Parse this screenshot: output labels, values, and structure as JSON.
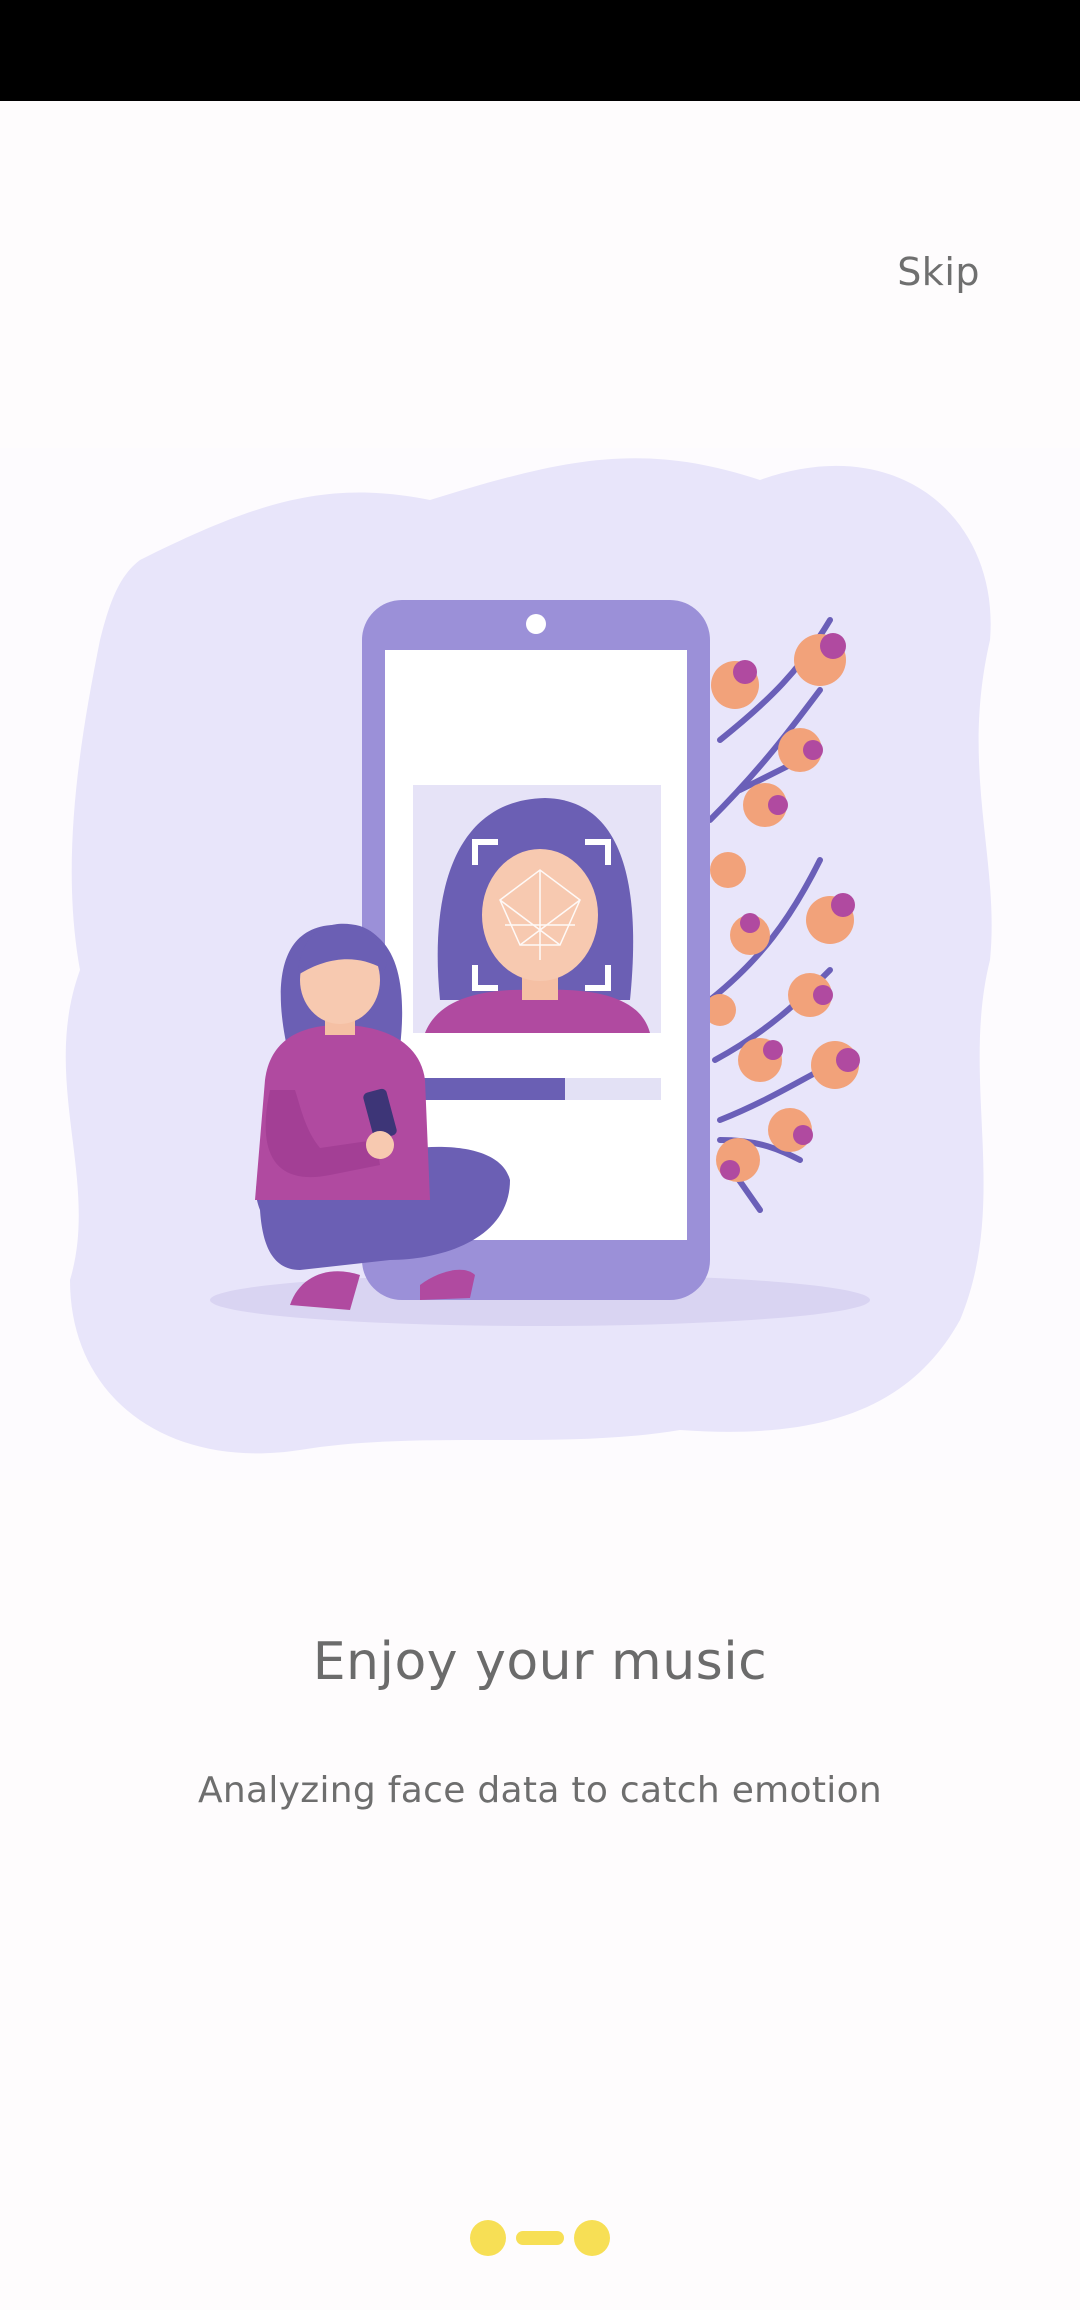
{
  "header": {
    "skip_label": "Skip"
  },
  "illustration": {
    "name": "face-scan-illustration"
  },
  "content": {
    "title": "Enjoy your music",
    "subtitle": "Analyzing face data to catch emotion"
  },
  "pager": {
    "count": 3,
    "active_index": 1
  },
  "colors": {
    "status_bar": "#000000",
    "background": "#fefcfd",
    "blob": "#e7e4fa",
    "phone": "#9a8fd6",
    "accent_purple": "#b04aa0",
    "flower": "#f2a27a",
    "pager_yellow": "#f7df55",
    "text": "#6b6b6b"
  }
}
